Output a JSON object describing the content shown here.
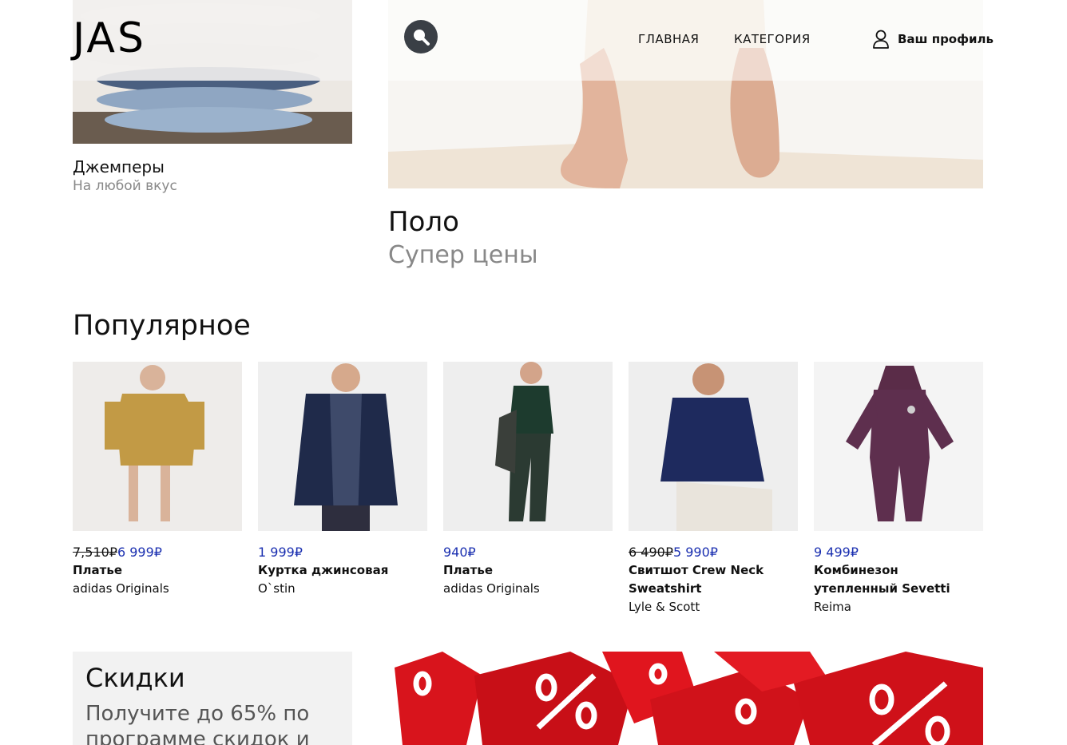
{
  "header": {
    "logo": "JAS",
    "nav": [
      {
        "label": "ГЛАВНАЯ"
      },
      {
        "label": "КАТЕГОРИЯ"
      }
    ],
    "profile_label": "Ваш профиль"
  },
  "hero": {
    "left": {
      "title": "Джемперы",
      "subtitle": "На любой вкус"
    },
    "right": {
      "title": "Поло",
      "subtitle": "Супер цены"
    }
  },
  "popular": {
    "title": "Популярное",
    "items": [
      {
        "old_price": "7,510₽",
        "price": "6 999₽",
        "name": "Платье",
        "brand": "adidas Originals"
      },
      {
        "old_price": "",
        "price": "1 999₽",
        "name": "Куртка джинсовая",
        "brand": "O`stin"
      },
      {
        "old_price": "",
        "price": "940₽",
        "name": "Платье",
        "brand": "adidas Originals"
      },
      {
        "old_price": "6 490₽",
        "price": "5 990₽",
        "name": "Свитшот Crew Neck Sweatshirt",
        "brand": "Lyle & Scott"
      },
      {
        "old_price": "",
        "price": "9 499₽",
        "name": "Комбинезон утепленный Sevetti",
        "brand": "Reima"
      }
    ]
  },
  "discounts": {
    "title": "Скидки",
    "text": "Получите до 65% по программе скидок и"
  },
  "colors": {
    "price_blue": "#1a2fb0",
    "search_bg": "#3a3f46",
    "sale_red": "#d8141c"
  }
}
